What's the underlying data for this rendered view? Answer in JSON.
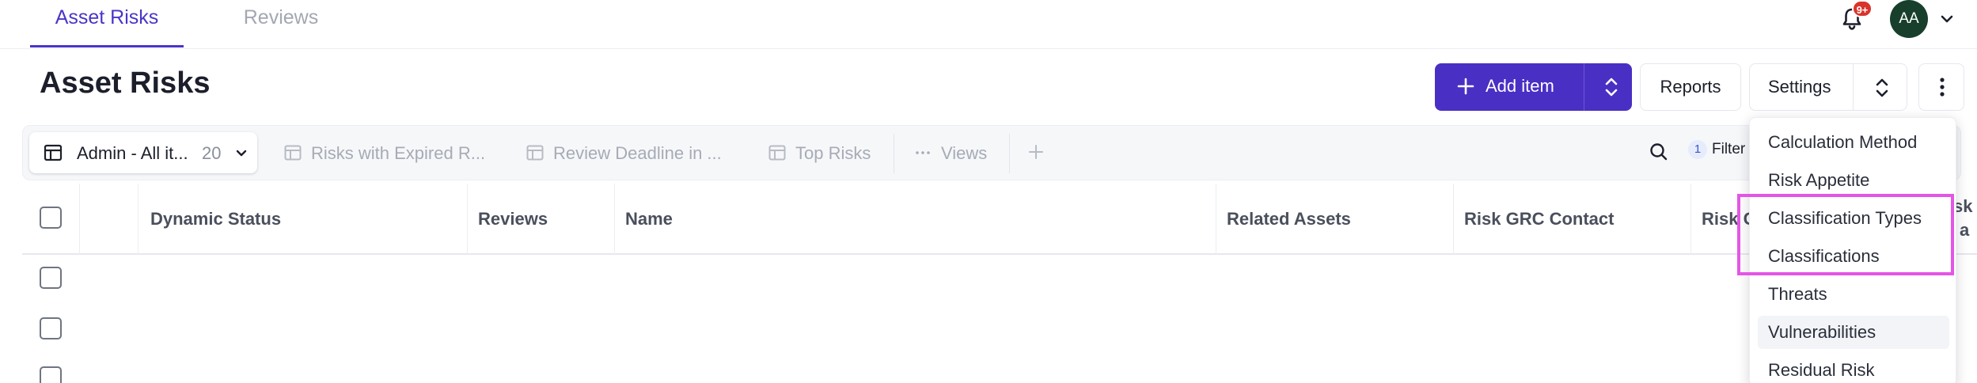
{
  "nav": {
    "tabs": [
      {
        "label": "Asset Risks",
        "active": true
      },
      {
        "label": "Reviews",
        "active": false
      }
    ],
    "notifications_badge": "9+",
    "avatar_initials": "AA",
    "accent_color": "#4a35c9"
  },
  "header": {
    "title": "Asset Risks",
    "add_item_label": "Add item",
    "reports_label": "Reports",
    "settings_label": "Settings"
  },
  "views": {
    "current": {
      "name": "Admin - All it...",
      "count": "20"
    },
    "tabs": [
      {
        "label": "Risks with Expired R..."
      },
      {
        "label": "Review Deadline in ..."
      },
      {
        "label": "Top Risks"
      }
    ],
    "more_views_label": "Views",
    "filter_count": "1",
    "filter_label": "Filter"
  },
  "table": {
    "columns": [
      "Dynamic Status",
      "Reviews",
      "Name",
      "Related Assets",
      "Risk GRC Contact",
      "Risk C"
    ],
    "clipped_column_fragment": [
      "sk",
      "a"
    ]
  },
  "settings_menu": {
    "items": [
      {
        "label": "Calculation Method"
      },
      {
        "label": "Risk Appetite"
      },
      {
        "label": "Classification Types"
      },
      {
        "label": "Classifications"
      },
      {
        "label": "Threats"
      },
      {
        "label": "Vulnerabilities",
        "hovered": true
      },
      {
        "label": "Residual Risk"
      }
    ],
    "highlight_color": "#e455e6"
  },
  "icons": [
    "bell-icon",
    "chevron-down-icon",
    "plus-icon",
    "updown-icon",
    "more-vertical-icon",
    "table-icon",
    "ellipsis-icon",
    "search-icon"
  ]
}
